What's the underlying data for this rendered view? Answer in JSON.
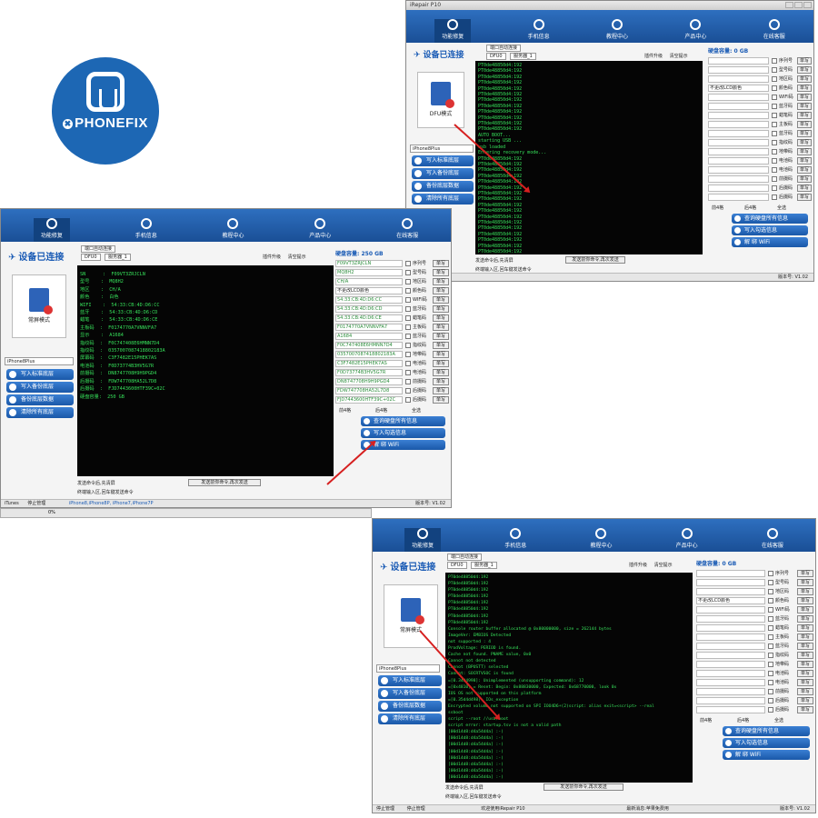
{
  "brand": {
    "name": "PHONEFIX",
    "mark": "✖"
  },
  "nav": [
    "功能修复",
    "手机信息",
    "教程中心",
    "产品中心",
    "在线客服"
  ],
  "app_title": "iRepair P10",
  "connected": "设备已连接",
  "modes": {
    "dfu": "DFU模式",
    "normal": "常屏模式"
  },
  "model": "iPhone8Plus",
  "toolbar": {
    "port_check": "端口自动连接",
    "port": "DFU0",
    "server": "服务器_1",
    "plugin": "插件升级",
    "clear": "清空提示"
  },
  "actions": [
    "写入标准底层",
    "写入备份底层",
    "备份底层数据",
    "清除所有底层"
  ],
  "disk_unknown": "硬盘容量: 0 GB",
  "disk_250": "硬盘容量: 250 GB",
  "fields": [
    "序列号",
    "型号码",
    "地区码",
    "颜色码",
    "WIFI码",
    "蓝牙码",
    "蜡笔码",
    "主板码",
    "蓝牙码",
    "指纹码",
    "地带码",
    "电池码",
    "电池码",
    "前摄码",
    "后摄码",
    "后摄码"
  ],
  "write_label": "单写",
  "checks": {
    "first": "前4格",
    "last": "后4格",
    "all": "全选"
  },
  "right_buttons": {
    "query": "查询硬盘所有信息",
    "write": "写入勾选信息",
    "wifi": "解 绑 WiFi"
  },
  "color_select": "不更改LCD颜色",
  "values_top": [
    "F09VT3ZRJCLN",
    "MQ8H2",
    "CH/A",
    "",
    "54:33:CB:4D:D6:CC",
    "54:33:CB:4D:D6:CD",
    "54:33:CB:4D:D6:CE",
    "F0174770A7VNNVFA7",
    "A1684",
    "F0C747408E6HMNN7D4",
    "0357007087418802183A",
    "C3F7482E15PHEK7AS",
    "F0D73774B3HV5G7R",
    "DN8747708H9H9PGD4",
    "FDW747708HA52L7D8",
    "FJD7443600HTF39C+02C"
  ],
  "info_term": [
    "SN      :  F09VT3ZRJCLN",
    "型号    :  MQ8H2",
    "地区    :  CH/A",
    "颜色    :  白色",
    "WIFI    :  54:33:CB:4D:D6:CC",
    "蓝牙    :  54:33:CB:4D:D6:CD",
    "蜡笔    :  54:33:CB:4D:D6:CE",
    "主板码  :  F0174770A7VNNVFA7",
    "显示    :  A1684",
    "指纹码  :  F0C747408E6HMNN7D4",
    "指纹码  :  0357007087418802183A",
    "屏幕码  :  C3F7482E15PHEK7AS",
    "电池码  :  F0D73774B3HV5G7R",
    "前摄码  :  DN8747708H9H9PGD4",
    "后摄码  :  FDW747708HA52L7D8",
    "后摄码  :  FJD7443600HTF39C+02C",
    "硬盘容量:  250 GB"
  ],
  "dfu_term": [
    "PT0de48850d4:192",
    "PT0de48850d4:192",
    "PT0de48850d4:192",
    "PT0de48850d4:192",
    "PT0de48850d4:192",
    "PT0de48850d4:192",
    "PT0de48850d4:192",
    "PT0de48850d4:192",
    "PT0de48850d4:192",
    "PT0de48850d4:192",
    "PT0de48850d4:192",
    "PT0de48850d4:192",
    "AUTO BOOT...",
    "starting USB ...",
    "usb loaded",
    "Entering recovery mode...",
    "PT0de48850d4:192",
    "PT0de48850d4:192",
    "PT0de48850d4:192",
    "PT0de48850d4:192",
    "PT0de48850d4:192",
    "PT0de48850d4:192",
    "PT0de48850d4:192",
    "PT0de48850d4:192",
    "PT0de48850d4:192",
    "PT0de48850d4:192",
    "PT0de48850d4:192",
    "PT0de48850d4:192",
    "PT0de48850d4:192",
    "PT0de48850d4:192",
    "PT0de48850d4:192",
    "PT0de48850d4:192",
    "PT0de48850d4:192"
  ],
  "boot_term": [
    "PT0de48850d4:192",
    "PT0de48850d4:192",
    "PT0de48850d4:192",
    "PT0de48850d4:192",
    "PT0de48850d4:192",
    "PT0de48850d4:192",
    "PT0de48850d4:192",
    "PT0de48850d4:192",
    "Console router buffer allocated @ 0x80000000, size = 262144 bytes",
    "ImageVer: EMBIOS Detected",
    "not supported : 4",
    "ProdVoltage: PERIOD is found.",
    "Cache not found. PNAME value, 0x0",
    "Cannot not detected",
    "Cannot (BPUSTT) selected",
    "Cannot: SOCRTVSOC is found",
    "=[0.34d4998]: Unimplemented (unsupporting command): 12",
    "=[0x4810] = Reset: Begin: 0x88830000, Expected: 0x68770000, look 0x",
    "IOS OS not supported on this platform",
    "=[0.35d4d498]  IOs_exception",
    "Encrypted volume not supported on SPI IOO4D6+(2)script: alias exit=<script> --real",
    "ssboot",
    "script --root //usb/boot",
    "script error: startup.tsv is not a valid path",
    "[00d14d8:d4a54d4a] :-)",
    "[00d14d8:d4a54d4a] :-)",
    "[00d14d8:d4a54d4a] :-)",
    "[00d14d8:d4a54d4a] :-)",
    "[00d14d8:d4a54d4a] :-)",
    "[00d14d8:d4a54d4a] :-)",
    "[00d14d8:d4a54d4a] :-)",
    "[00d14d8:d4a54d4a] :-)"
  ],
  "cmd_check": "发送命令后,先清屏",
  "cmd_button": "发送前你命令,再次发送",
  "cmd_hint": "终端输入区,回车键发送命令",
  "status": {
    "stop": "停止管理",
    "itunes": "iTunes",
    "models": "iPhone8,iPhone8P, iPhone7,iPhone7P",
    "ver": "版本号: V1.02",
    "welcome": "欢迎使用iRepair P10",
    "mode_hint": "最新消息:苹果免费用"
  },
  "progress": "0%"
}
